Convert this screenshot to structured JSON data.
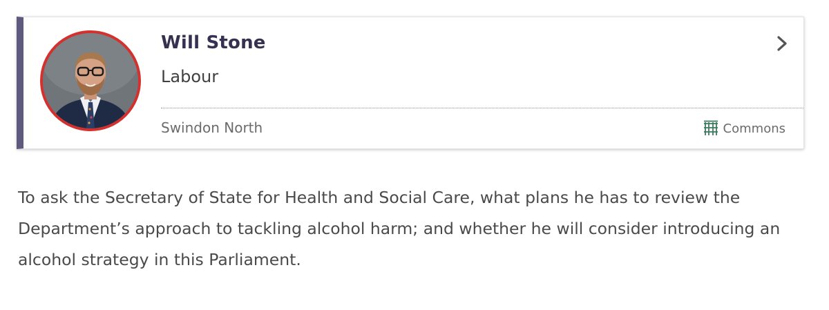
{
  "member": {
    "name": "Will Stone",
    "party": "Labour",
    "constituency": "Swindon North",
    "house": "Commons",
    "party_color": "#d4312e",
    "accent_color": "#5e5a7e",
    "house_color": "#3c7a5f",
    "avatar_icon": "member-portrait",
    "chevron_icon": "chevron-right-icon",
    "house_icon": "portcullis-icon"
  },
  "question": {
    "text": "To ask the Secretary of State for Health and Social Care, what plans he has to review the Department’s approach to tackling alcohol harm; and whether he will consider introducing an alcohol strategy in this Parliament."
  }
}
